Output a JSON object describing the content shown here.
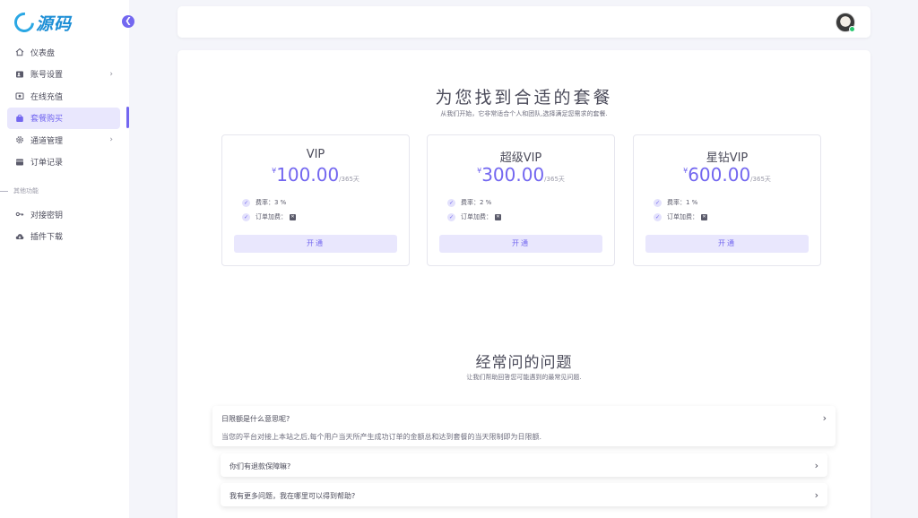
{
  "brand": {
    "logo_text": "源码",
    "collapse_icon": "chevron-left-icon"
  },
  "sidebar": {
    "items": [
      {
        "label": "仪表盘",
        "icon": "home-icon"
      },
      {
        "label": "账号设置",
        "icon": "user-card-icon",
        "has_submenu": true
      },
      {
        "label": "在线充值",
        "icon": "wallet-icon"
      },
      {
        "label": "套餐购买",
        "icon": "shopping-bag-icon",
        "active": true
      },
      {
        "label": "通道管理",
        "icon": "gear-icon",
        "has_submenu": true
      },
      {
        "label": "订单记录",
        "icon": "order-icon"
      }
    ],
    "section_label": "其他功能",
    "other_items": [
      {
        "label": "对接密钥",
        "icon": "key-icon"
      },
      {
        "label": "插件下载",
        "icon": "cloud-download-icon"
      }
    ]
  },
  "header": {
    "avatar_icon": "user-avatar",
    "status_color": "#28c76f"
  },
  "pricing": {
    "title": "为您找到合适的套餐",
    "subtitle": "从我们开始，它非常适合个人和团队,选择满足您需求的套餐.",
    "plans": [
      {
        "name": "VIP",
        "currency": "¥",
        "price": "100.00",
        "period": "/365天",
        "rate_label": "费率：",
        "rate_value": "3 %",
        "order_fee_label": "订单加费：",
        "order_fee_icon": "x-box-icon",
        "button": "开通"
      },
      {
        "name": "超级VIP",
        "currency": "¥",
        "price": "300.00",
        "period": "/365天",
        "rate_label": "费率：",
        "rate_value": "2 %",
        "order_fee_label": "订单加费：",
        "order_fee_icon": "x-box-icon",
        "button": "开通"
      },
      {
        "name": "星钻VIP",
        "currency": "¥",
        "price": "600.00",
        "period": "/365天",
        "rate_label": "费率：",
        "rate_value": "1 %",
        "order_fee_label": "订单加费：",
        "order_fee_icon": "x-box-icon",
        "button": "开通"
      }
    ]
  },
  "faq": {
    "title": "经常问的问题",
    "subtitle": "让我们帮助回答您可能遇到的最常见问题.",
    "items": [
      {
        "question": "日限额是什么意思呢?",
        "answer": "当您的平台对接上本站之后,每个用户当天所产生成功订单的金额总和达到套餐的当天限制即为日限额.",
        "expanded": true
      },
      {
        "question": "你们有退款保障嘛?",
        "expanded": false
      },
      {
        "question": "我有更多问题，我在哪里可以得到帮助?",
        "expanded": false
      }
    ]
  },
  "colors": {
    "accent": "#7367f0",
    "accent_light": "#e9e7fd",
    "background": "#f4f5fa"
  }
}
